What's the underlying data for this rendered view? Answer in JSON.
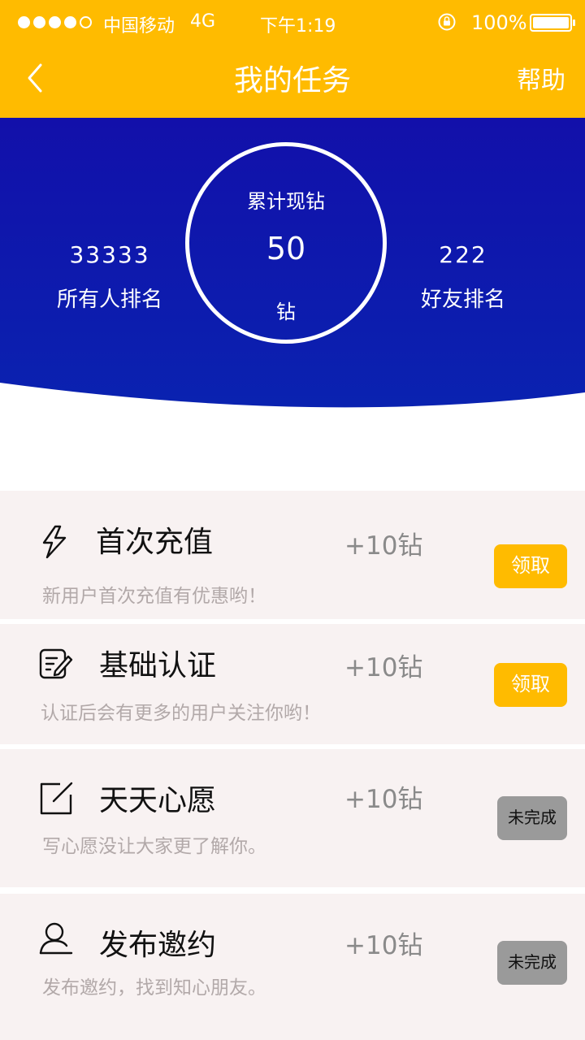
{
  "status_bar": {
    "carrier": "中国移动",
    "network": "4G",
    "time": "下午1:19",
    "battery": "100%"
  },
  "nav": {
    "title": "我的任务",
    "help": "帮助"
  },
  "summary": {
    "all_rank_value": "33333",
    "all_rank_label": "所有人排名",
    "total_label": "累计现钻",
    "total_value": "50",
    "total_unit": "钻",
    "friend_rank_value": "222",
    "friend_rank_label": "好友排名"
  },
  "tasks": [
    {
      "name": "首次充值",
      "reward": "+10钻",
      "desc": "新用户首次充值有优惠哟！",
      "action": "领取",
      "icon": "lightning-icon"
    },
    {
      "name": "基础认证",
      "reward": "+10钻",
      "desc": "认证后会有更多的用户关注你哟！",
      "action": "领取",
      "icon": "edit-document-icon"
    },
    {
      "name": "天天心愿",
      "reward": "+10钻",
      "desc": "写心愿没让大家更了解你。",
      "action": "未完成",
      "icon": "write-note-icon"
    },
    {
      "name": "发布邀约",
      "reward": "+10钻",
      "desc": "发布邀约，找到知心朋友。",
      "action": "未完成",
      "icon": "user-icon"
    }
  ],
  "colors": {
    "brand": "#FFBB00",
    "hero_blue": "#0F0FAE",
    "card_bg": "#F8F2F2",
    "pending_gray": "#9A9A9A"
  }
}
